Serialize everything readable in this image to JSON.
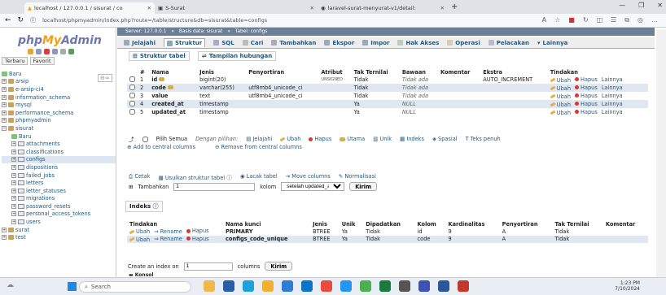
{
  "browser": {
    "tabs": [
      {
        "title": "localhost / 127.0.0.1 / sisurat / co",
        "active": true
      },
      {
        "title": "S-Surat",
        "active": false
      },
      {
        "title": "laravel-surat-menyurat-v1/detail:",
        "active": false
      }
    ],
    "new_tab": "+",
    "url": "localhost/phpmyadmin/index.php?route=/table/structure&db=sisurat&table=configs"
  },
  "pma": {
    "logo_php": "php",
    "logo_my": "My",
    "logo_admin": "Admin",
    "left_tabs": [
      "Terbaru",
      "Favorit"
    ],
    "tree": [
      {
        "label": "Baru",
        "level": 0,
        "type": "new"
      },
      {
        "label": "arsip",
        "level": 0,
        "type": "db"
      },
      {
        "label": "e-arsip-ci4",
        "level": 0,
        "type": "db"
      },
      {
        "label": "information_schema",
        "level": 0,
        "type": "db"
      },
      {
        "label": "mysql",
        "level": 0,
        "type": "db"
      },
      {
        "label": "performance_schema",
        "level": 0,
        "type": "db"
      },
      {
        "label": "phpmyadmin",
        "level": 0,
        "type": "db"
      },
      {
        "label": "sisurat",
        "level": 0,
        "type": "db-open"
      },
      {
        "label": "Baru",
        "level": 1,
        "type": "new"
      },
      {
        "label": "attachments",
        "level": 1,
        "type": "table"
      },
      {
        "label": "classifications",
        "level": 1,
        "type": "table"
      },
      {
        "label": "configs",
        "level": 1,
        "type": "table-active"
      },
      {
        "label": "dispositions",
        "level": 1,
        "type": "table"
      },
      {
        "label": "failed_jobs",
        "level": 1,
        "type": "table"
      },
      {
        "label": "letters",
        "level": 1,
        "type": "table"
      },
      {
        "label": "letter_statuses",
        "level": 1,
        "type": "table"
      },
      {
        "label": "migrations",
        "level": 1,
        "type": "table"
      },
      {
        "label": "password_resets",
        "level": 1,
        "type": "table"
      },
      {
        "label": "personal_access_tokens",
        "level": 1,
        "type": "table"
      },
      {
        "label": "users",
        "level": 1,
        "type": "table"
      },
      {
        "label": "surat",
        "level": 0,
        "type": "db"
      },
      {
        "label": "test",
        "level": 0,
        "type": "db"
      }
    ],
    "breadcrumb": [
      "Server: 127.0.0.1",
      "Basis data: sisurat",
      "Tabel: configs"
    ],
    "menu": [
      "Jelajahi",
      "Struktur",
      "SQL",
      "Cari",
      "Tambahkan",
      "Ekspor",
      "Impor",
      "Hak Akses",
      "Operasi",
      "Pelacakan",
      "Lainnya"
    ],
    "subtabs": [
      "Struktur tabel",
      "Tampilan hubungan"
    ],
    "struct_headers": [
      "#",
      "Nama",
      "Jenis",
      "Penyortiran",
      "Atribut",
      "Tak Ternilai",
      "Bawaan",
      "Komentar",
      "Ekstra",
      "Tindakan"
    ],
    "columns": [
      {
        "num": "1",
        "name": "id",
        "type": "bigint(20)",
        "collation": "",
        "attr": "UNSIGNED",
        "null": "Tidak",
        "default": "Tidak ada",
        "comment": "",
        "extra": "AUTO_INCREMENT",
        "key": true
      },
      {
        "num": "2",
        "name": "code",
        "type": "varchar(255)",
        "collation": "utf8mb4_unicode_ci",
        "attr": "",
        "null": "Tidak",
        "default": "Tidak ada",
        "comment": "",
        "extra": "",
        "key": true
      },
      {
        "num": "3",
        "name": "value",
        "type": "text",
        "collation": "utf8mb4_unicode_ci",
        "attr": "",
        "null": "Tidak",
        "default": "Tidak ada",
        "comment": "",
        "extra": "",
        "key": false
      },
      {
        "num": "4",
        "name": "created_at",
        "type": "timestamp",
        "collation": "",
        "attr": "",
        "null": "Ya",
        "default": "NULL",
        "comment": "",
        "extra": "",
        "key": false
      },
      {
        "num": "5",
        "name": "updated_at",
        "type": "timestamp",
        "collation": "",
        "attr": "",
        "null": "Ya",
        "default": "NULL",
        "comment": "",
        "extra": "",
        "key": false
      }
    ],
    "row_actions": {
      "ubah": "Ubah",
      "hapus": "Hapus",
      "lainnya": "Lainnya"
    },
    "bulk": {
      "pilih_semua": "Pilih Semua",
      "dengan_pilihan": "Dengan pilihan:",
      "jelajahi": "Jelajahi",
      "ubah": "Ubah",
      "hapus": "Hapus",
      "utama": "Utama",
      "unik": "Unik",
      "indeks": "Indeks",
      "spasial": "Spasial",
      "teks_penuh": "Teks penuh"
    },
    "bulk2": {
      "add_central": "Add to central columns",
      "remove_central": "Remove from central columns"
    },
    "tools": {
      "cetak": "Cetak",
      "usulkan": "Usulkan struktur tabel",
      "lacak": "Lacak tabel",
      "move": "Move columns",
      "normalisasi": "Normalisasi"
    },
    "addcol": {
      "tambahkan": "Tambahkan",
      "count": "1",
      "kolom": "kolom",
      "position": "setelah updated_at",
      "kirim": "Kirim"
    },
    "indexes_title": "Indeks",
    "idx_headers": [
      "Tindakan",
      "Nama kunci",
      "Jenis",
      "Unik",
      "Dipadatkan",
      "Kolom",
      "Kardinalitas",
      "Penyortiran",
      "Tak Ternilai",
      "Komentar"
    ],
    "idx_actions": {
      "ubah": "Ubah",
      "rename": "Rename",
      "hapus": "Hapus"
    },
    "indexes": [
      {
        "name": "PRIMARY",
        "type": "BTREE",
        "unique": "Ya",
        "packed": "Tidak",
        "column": "id",
        "card": "9",
        "coll": "A",
        "null": "Tidak"
      },
      {
        "name": "configs_code_unique",
        "type": "BTREE",
        "unique": "Ya",
        "packed": "Tidak",
        "column": "code",
        "card": "9",
        "coll": "A",
        "null": "Tidak"
      }
    ],
    "create_index": {
      "label": "Create an index on",
      "count": "1",
      "columns": "columns",
      "kirim": "Kirim"
    },
    "konsol": "Konsol"
  },
  "taskbar": {
    "search": "Search",
    "time": "1:23 PM",
    "date": "7/10/2024"
  },
  "colors": {
    "accent": "#235a81",
    "menubar": "#eeeeee",
    "breadcrumb": "#6b7f95"
  }
}
